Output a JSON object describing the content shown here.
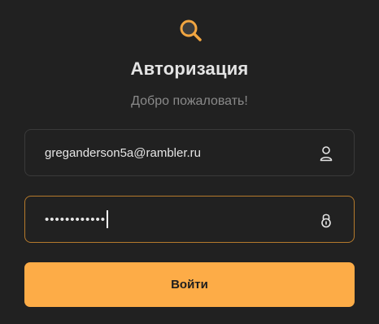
{
  "header": {
    "logo_icon": "magnifier-logo-icon",
    "title": "Авторизация",
    "subtitle": "Добро пожаловать!"
  },
  "form": {
    "login": {
      "value": "greganderson5a@rambler.ru",
      "icon": "user-icon"
    },
    "password": {
      "masked_value": "••••••••••••",
      "icon": "lock-icon",
      "focused": true
    },
    "submit_label": "Войти"
  },
  "colors": {
    "background": "#212121",
    "accent": "#fdac47",
    "focused_border": "#b57a2c",
    "title": "#e4e4e4",
    "subtitle": "#8a8a8a"
  }
}
